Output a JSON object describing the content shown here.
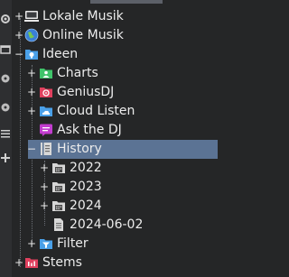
{
  "tree": {
    "items": [
      {
        "label": "Lokale Musik",
        "expander": "+",
        "icon": "computer-icon"
      },
      {
        "label": "Online Musik",
        "expander": "+",
        "icon": "globe-icon"
      },
      {
        "label": "Ideen",
        "expander": "−",
        "icon": "idea-folder-icon"
      },
      {
        "label": "Charts",
        "expander": "+",
        "icon": "charts-icon"
      },
      {
        "label": "GeniusDJ",
        "expander": "+",
        "icon": "genius-dj-icon"
      },
      {
        "label": "Cloud Listen",
        "expander": "+",
        "icon": "cloud-folder-icon"
      },
      {
        "label": "Ask the DJ",
        "expander": "",
        "icon": "chat-icon"
      },
      {
        "label": "History",
        "expander": "−",
        "icon": "history-icon"
      },
      {
        "label": "2022",
        "expander": "+",
        "icon": "calendar-folder-icon"
      },
      {
        "label": "2023",
        "expander": "+",
        "icon": "calendar-folder-icon"
      },
      {
        "label": "2024",
        "expander": "+",
        "icon": "calendar-folder-icon"
      },
      {
        "label": "2024-06-02",
        "expander": "",
        "icon": "document-icon"
      },
      {
        "label": "Filter",
        "expander": "+",
        "icon": "filter-icon"
      },
      {
        "label": "Stems",
        "expander": "+",
        "icon": "stems-icon"
      }
    ]
  },
  "colors": {
    "background": "#252627",
    "selection": "#5b7394",
    "text": "#ececec",
    "toolstrip": "#2e2f31"
  }
}
